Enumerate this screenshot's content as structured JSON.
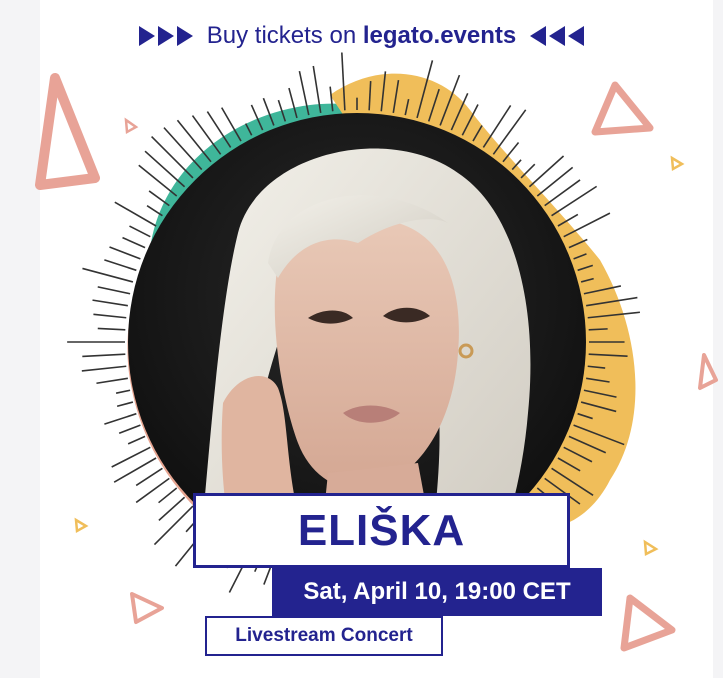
{
  "header": {
    "prefix": "Buy tickets on ",
    "site": "legato.events",
    "arrow_icon_left": "triple-triangle-right-icon",
    "arrow_icon_right": "triple-triangle-left-icon"
  },
  "artist": {
    "name": "ELIŠKA"
  },
  "event": {
    "date_time": "Sat, April 10, 19:00 CET",
    "type": "Livestream Concert"
  },
  "colors": {
    "navy": "#23238f",
    "teal": "#3fb69a",
    "mustard": "#f0be5a",
    "salmon": "#e7a591",
    "coral_outline": "#e8a397"
  }
}
